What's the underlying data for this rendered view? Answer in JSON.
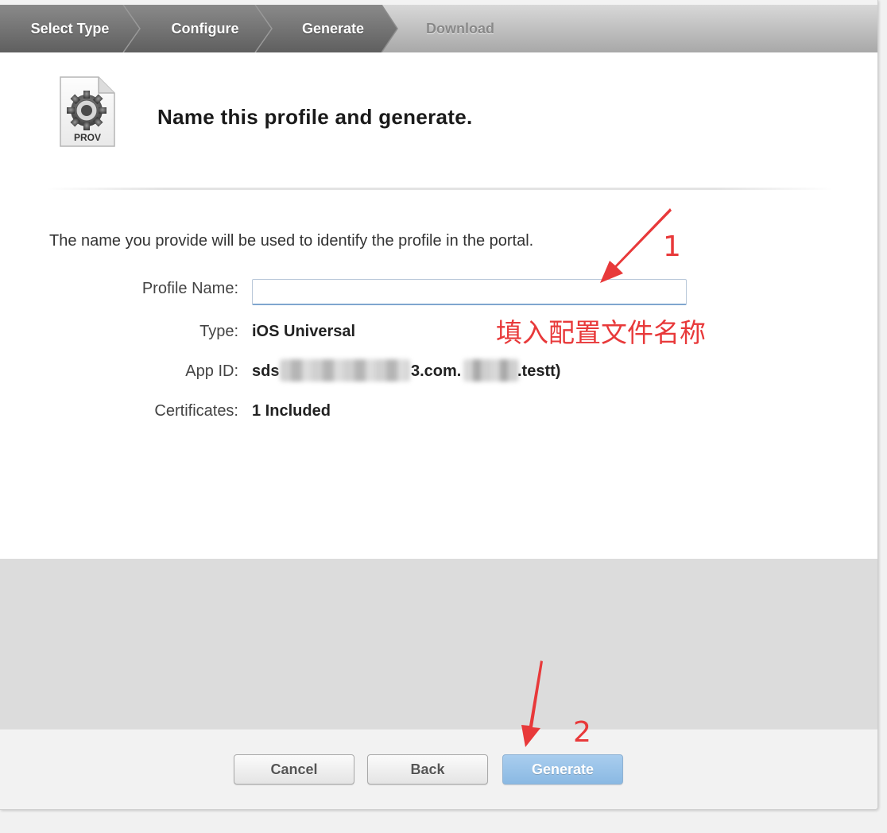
{
  "steps": [
    {
      "label": "Select Type",
      "state": "completed"
    },
    {
      "label": "Configure",
      "state": "completed"
    },
    {
      "label": "Generate",
      "state": "current"
    },
    {
      "label": "Download",
      "state": "pending"
    }
  ],
  "header": {
    "icon_label": "PROV",
    "title": "Name this profile and generate."
  },
  "form": {
    "description": "The name you provide will be used to identify the profile in the portal.",
    "profile_name_label": "Profile Name:",
    "profile_name_value": "",
    "type_label": "Type:",
    "type_value": "iOS Universal",
    "app_id_label": "App ID:",
    "app_id_prefix": "sds",
    "app_id_middle": "3.com.",
    "app_id_suffix": ".testt)",
    "certificates_label": "Certificates:",
    "certificates_value": "1 Included"
  },
  "annotations": {
    "step1_number": "1",
    "step1_note": "填入配置文件名称",
    "step2_number": "2",
    "color": "#e8393a"
  },
  "buttons": {
    "cancel": "Cancel",
    "back": "Back",
    "generate": "Generate"
  },
  "colors": {
    "step_active": "#6e6e6e",
    "step_inactive": "#b8b8b8",
    "primary_button": "#9bc4ea"
  }
}
